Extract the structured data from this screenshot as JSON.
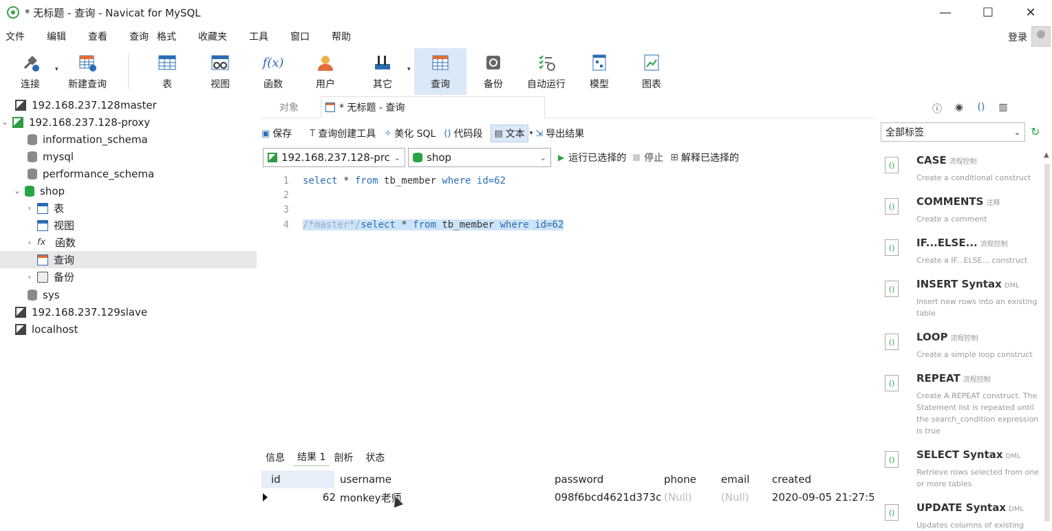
{
  "window": {
    "title": "* 无标题 - 查询 - Navicat for MySQL",
    "min": "—",
    "max": "☐",
    "close": "✕"
  },
  "menu": [
    "文件",
    "编辑",
    "查看",
    "查询",
    "格式",
    "收藏夹",
    "工具",
    "窗口",
    "帮助"
  ],
  "login_label": "登录",
  "toolbar": [
    {
      "label": "连接",
      "icon": "connect-icon"
    },
    {
      "label": "新建查询",
      "icon": "new-query-icon"
    },
    {
      "label": "表",
      "icon": "table-icon"
    },
    {
      "label": "视图",
      "icon": "view-icon"
    },
    {
      "label": "函数",
      "icon": "function-icon",
      "glyph": "f(x)"
    },
    {
      "label": "用户",
      "icon": "user-icon"
    },
    {
      "label": "其它",
      "icon": "tools-icon"
    },
    {
      "label": "查询",
      "icon": "query-icon"
    },
    {
      "label": "备份",
      "icon": "backup-icon"
    },
    {
      "label": "自动运行",
      "icon": "schedule-icon"
    },
    {
      "label": "模型",
      "icon": "model-icon"
    },
    {
      "label": "图表",
      "icon": "chart-icon"
    }
  ],
  "navigator": [
    {
      "label": "192.168.237.128master",
      "type": "connection"
    },
    {
      "label": "192.168.237.128-proxy",
      "type": "connection-open"
    },
    {
      "label": "information_schema",
      "type": "database"
    },
    {
      "label": "mysql",
      "type": "database"
    },
    {
      "label": "performance_schema",
      "type": "database"
    },
    {
      "label": "shop",
      "type": "database-open"
    },
    {
      "label": "表",
      "type": "tables"
    },
    {
      "label": "视图",
      "type": "views"
    },
    {
      "label": "函数",
      "type": "functions"
    },
    {
      "label": "查询",
      "type": "queries"
    },
    {
      "label": "备份",
      "type": "backups"
    },
    {
      "label": "sys",
      "type": "database"
    },
    {
      "label": "192.168.237.129slave",
      "type": "connection"
    },
    {
      "label": "localhost",
      "type": "connection"
    }
  ],
  "tabs": {
    "objects": "对象",
    "query": "* 无标题 - 查询"
  },
  "editor_toolbar": {
    "save": "保存",
    "builder": "查询创建工具",
    "beautify": "美化 SQL",
    "snippet": "代码段",
    "text": "文本",
    "export": "导出结果"
  },
  "selectors": {
    "connection": "192.168.237.128-prc",
    "database": "shop",
    "run": "运行已选择的",
    "stop": "停止",
    "explain": "解释已选择的"
  },
  "code": {
    "line_numbers": [
      "1",
      "2",
      "3",
      "4"
    ],
    "line1": {
      "k1": "select",
      "t1": " * ",
      "k2": "from",
      "t2": " tb_member ",
      "k3": "where",
      "t3": " id=62"
    },
    "line4": {
      "c": "/*master*/",
      "k1": "select",
      "t1": " * ",
      "k2": "from",
      "t2": " tb_member ",
      "k3": "where",
      "t3": " id=62"
    }
  },
  "result_tabs": [
    "信息",
    "结果 1",
    "剖析",
    "状态"
  ],
  "grid": {
    "columns": [
      "id",
      "username",
      "password",
      "phone",
      "email",
      "created"
    ],
    "rows": [
      {
        "id": "62",
        "username": "monkey老师",
        "password": "098f6bcd4621d373c",
        "phone": "(Null)",
        "email": "(Null)",
        "created": "2020-09-05 21:27:5"
      }
    ]
  },
  "right_panel": {
    "filter": "全部标签",
    "snippets": [
      {
        "title": "CASE",
        "tag": "流程控制",
        "desc": "Create a conditional construct"
      },
      {
        "title": "COMMENTS",
        "tag": "注释",
        "desc": "Create a comment"
      },
      {
        "title": "IF...ELSE...",
        "tag": "流程控制",
        "desc": "Create a IF...ELSE... construct"
      },
      {
        "title": "INSERT Syntax",
        "tag": "DML",
        "desc": "Insert new rows into an existing table"
      },
      {
        "title": "LOOP",
        "tag": "流程控制",
        "desc": "Create a simple loop construct"
      },
      {
        "title": "REPEAT",
        "tag": "流程控制",
        "desc": "Create A REPEAT construct. The Statement list is repeated until the search_condition expression is true"
      },
      {
        "title": "SELECT Syntax",
        "tag": "DML",
        "desc": "Retrieve rows selected from one or more tables"
      },
      {
        "title": "UPDATE Syntax",
        "tag": "DML",
        "desc": "Updates columns of existing"
      }
    ]
  }
}
